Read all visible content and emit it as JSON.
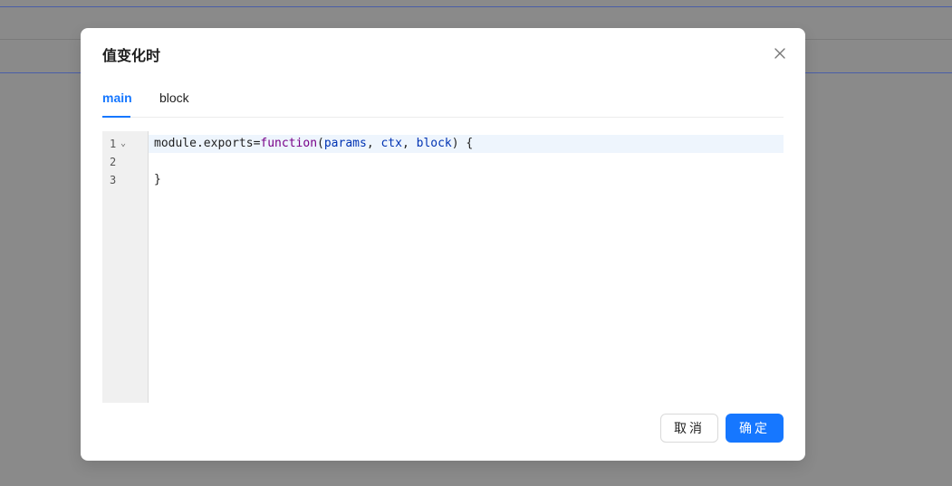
{
  "modal": {
    "title": "值变化时",
    "close_icon": "close-icon"
  },
  "tabs": [
    {
      "label": "main",
      "active": true
    },
    {
      "label": "block",
      "active": false
    }
  ],
  "editor": {
    "line_numbers": [
      "1",
      "2",
      "3"
    ],
    "fold_icon": "chevron-down-icon",
    "lines": {
      "l1": {
        "prefix": "module.exports=",
        "keyword": "function",
        "open": "(",
        "p1": "params",
        "sep1": ", ",
        "p2": "ctx",
        "sep2": ", ",
        "p3": "block",
        "close": ") {"
      },
      "l2": "",
      "l3": "}"
    }
  },
  "footer": {
    "cancel_label": "取消",
    "ok_label": "确定"
  },
  "colors": {
    "accent": "#1677ff",
    "backdrop": "#8a8a8a",
    "keyword": "#770088",
    "param": "#0033b3"
  }
}
